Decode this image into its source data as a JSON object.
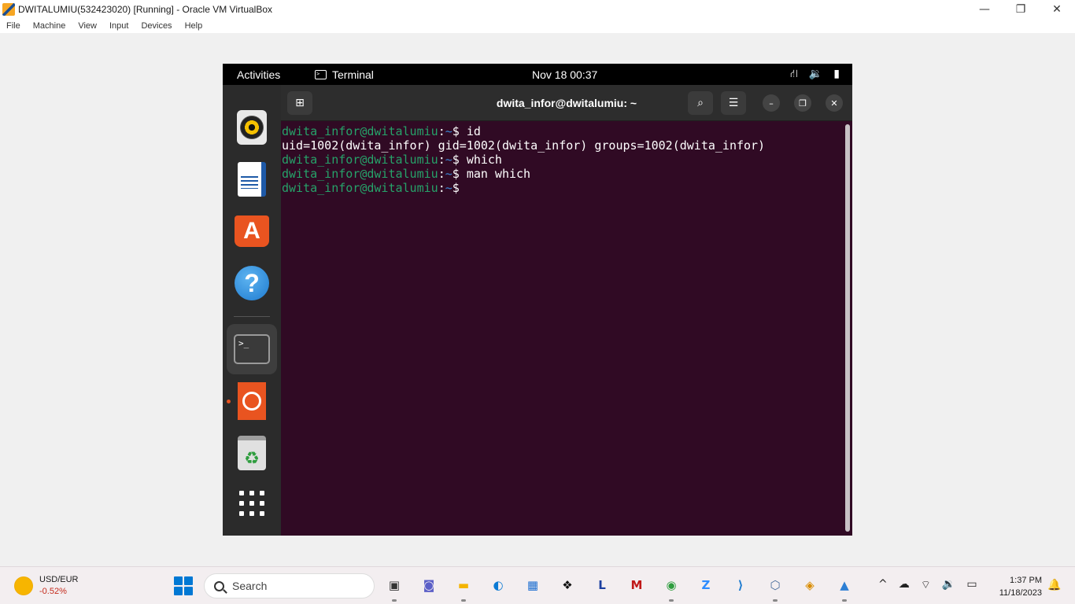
{
  "host": {
    "window_title": "DWITALUMIU(532423020) [Running] - Oracle VM VirtualBox",
    "window_controls": {
      "minimize": "—",
      "restore": "❐",
      "close": "✕"
    },
    "menu": [
      "File",
      "Machine",
      "View",
      "Input",
      "Devices",
      "Help"
    ]
  },
  "guest": {
    "topbar": {
      "activities": "Activities",
      "app_name": "Terminal",
      "clock": "Nov 18  00:37",
      "tray": {
        "network": "⛙",
        "volume": "🔉",
        "battery": "▮"
      }
    },
    "dock": {
      "items": [
        "rhythmbox-icon",
        "libreoffice-writer-icon",
        "ubuntu-software-icon",
        "help-icon",
        "terminal-icon",
        "ubuntu-icon",
        "trash-icon",
        "show-apps-icon"
      ]
    },
    "terminal": {
      "title": "dwita_infor@dwitalumiu: ~",
      "new_tab": "⊞",
      "search": "⌕",
      "menu": "☰",
      "minimize": "–",
      "maximize": "❐",
      "close": "✕",
      "prompt_user": "dwita_infor@dwitalumiu",
      "prompt_path": "~",
      "lines": [
        {
          "type": "prompt",
          "cmd": "id"
        },
        {
          "type": "output",
          "text": "uid=1002(dwita_infor) gid=1002(dwita_infor) groups=1002(dwita_infor)"
        },
        {
          "type": "prompt",
          "cmd": "which"
        },
        {
          "type": "prompt",
          "cmd": "man which"
        },
        {
          "type": "prompt",
          "cmd": ""
        }
      ]
    }
  },
  "taskbar": {
    "widget": {
      "title": "USD/EUR",
      "value": "-0.52%"
    },
    "search_placeholder": "Search",
    "apps": [
      {
        "name": "task-view",
        "glyph": "▣",
        "color": "#333333"
      },
      {
        "name": "teams",
        "glyph": "◙",
        "color": "#5b5fc7"
      },
      {
        "name": "file-explorer",
        "glyph": "▬",
        "color": "#f4b400"
      },
      {
        "name": "edge",
        "glyph": "◐",
        "color": "#0c7ad4"
      },
      {
        "name": "ms-store",
        "glyph": "▦",
        "color": "#1e6fd1"
      },
      {
        "name": "dropbox",
        "glyph": "❖",
        "color": "#0f0f0f"
      },
      {
        "name": "lightshot",
        "glyph": "L",
        "color": "#1c3fa0"
      },
      {
        "name": "mcafee",
        "glyph": "M",
        "color": "#c01818"
      },
      {
        "name": "chrome",
        "glyph": "◉",
        "color": "#2e9d3e"
      },
      {
        "name": "zoom",
        "glyph": "Z",
        "color": "#2d8cff"
      },
      {
        "name": "vscode",
        "glyph": "⟩",
        "color": "#1e7bd0"
      },
      {
        "name": "virtualbox",
        "glyph": "⬡",
        "color": "#4a6e9c"
      },
      {
        "name": "virtualbox-vm",
        "glyph": "◈",
        "color": "#d98c00"
      },
      {
        "name": "photos",
        "glyph": "▲",
        "color": "#2d7fd4"
      }
    ],
    "tray": {
      "chevron": "^",
      "onedrive": "☁",
      "wifi": "⌔",
      "volume": "🔉",
      "battery": "▭"
    },
    "time": "1:37 PM",
    "date": "11/18/2023",
    "bell": "🔔"
  }
}
